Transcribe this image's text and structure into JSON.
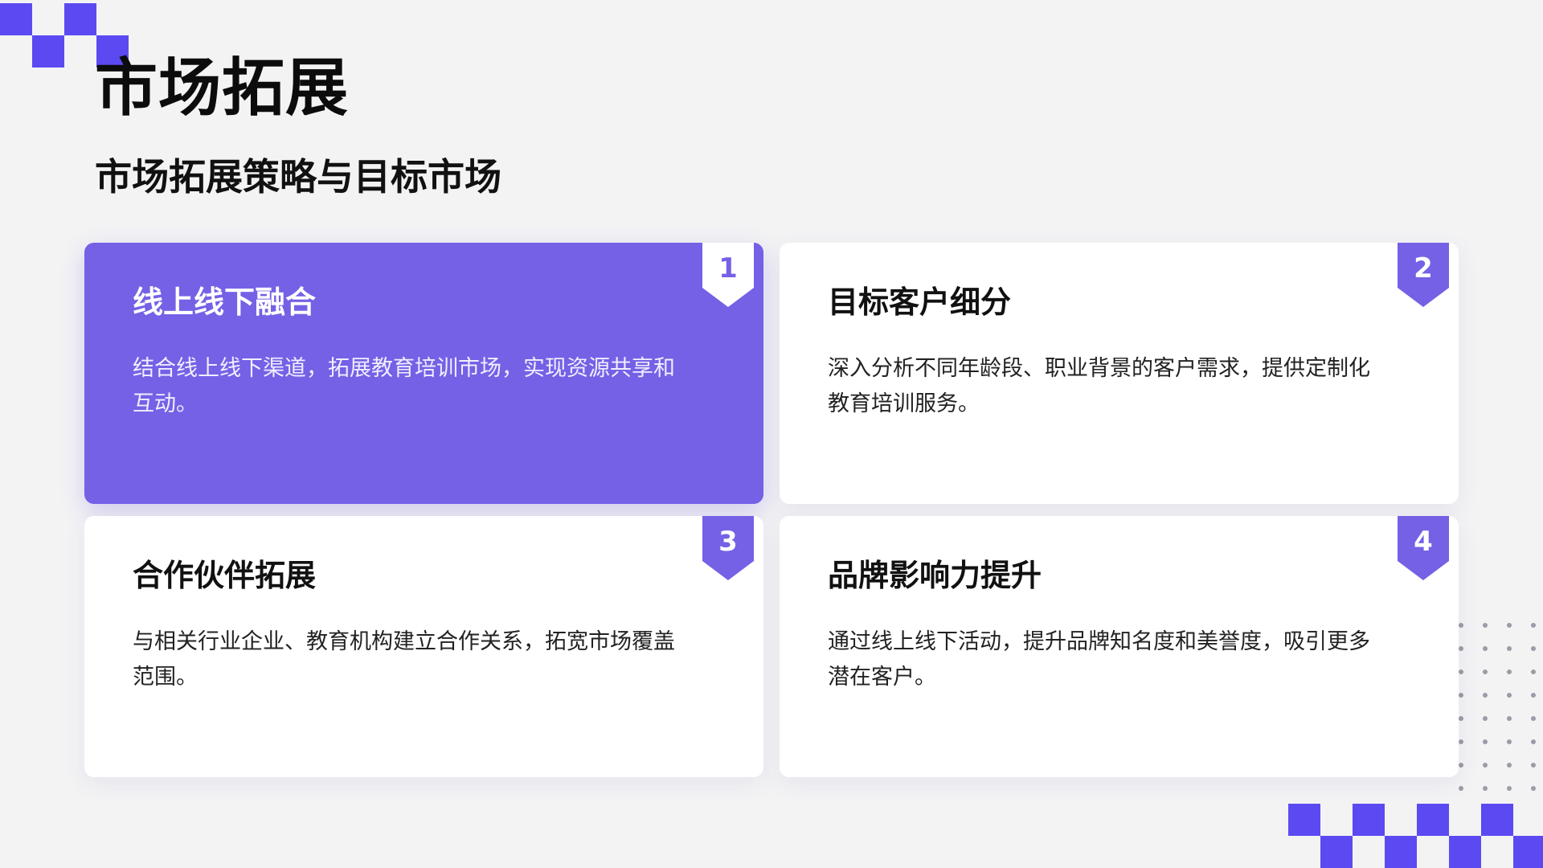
{
  "title": "市场拓展",
  "subtitle": "市场拓展策略与目标市场",
  "colors": {
    "accent": "#5b4af2",
    "active_card": "#7461e6",
    "background": "#f3f3f4",
    "card": "#ffffff"
  },
  "cards": [
    {
      "number": "1",
      "title": "线上线下融合",
      "description": "结合线上线下渠道，拓展教育培训市场，实现资源共享和互动。",
      "highlighted": true
    },
    {
      "number": "2",
      "title": "目标客户细分",
      "description": "深入分析不同年龄段、职业背景的客户需求，提供定制化教育培训服务。",
      "highlighted": false
    },
    {
      "number": "3",
      "title": "合作伙伴拓展",
      "description": "与相关行业企业、教育机构建立合作关系，拓宽市场覆盖范围。",
      "highlighted": false
    },
    {
      "number": "4",
      "title": "品牌影响力提升",
      "description": "通过线上线下活动，提升品牌知名度和美誉度，吸引更多潜在客户。",
      "highlighted": false
    }
  ]
}
